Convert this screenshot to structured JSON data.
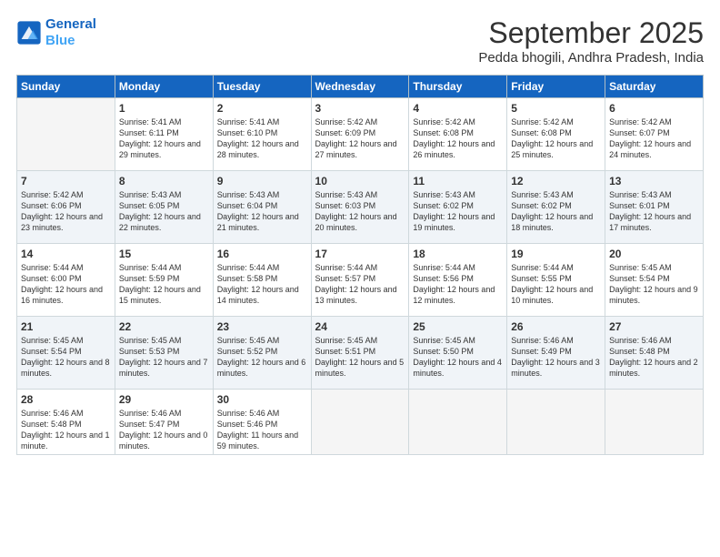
{
  "header": {
    "logo_line1": "General",
    "logo_line2": "Blue",
    "month": "September 2025",
    "location": "Pedda bhogili, Andhra Pradesh, India"
  },
  "weekdays": [
    "Sunday",
    "Monday",
    "Tuesday",
    "Wednesday",
    "Thursday",
    "Friday",
    "Saturday"
  ],
  "weeks": [
    [
      {
        "day": "",
        "info": ""
      },
      {
        "day": "1",
        "info": "Sunrise: 5:41 AM\nSunset: 6:11 PM\nDaylight: 12 hours\nand 29 minutes."
      },
      {
        "day": "2",
        "info": "Sunrise: 5:41 AM\nSunset: 6:10 PM\nDaylight: 12 hours\nand 28 minutes."
      },
      {
        "day": "3",
        "info": "Sunrise: 5:42 AM\nSunset: 6:09 PM\nDaylight: 12 hours\nand 27 minutes."
      },
      {
        "day": "4",
        "info": "Sunrise: 5:42 AM\nSunset: 6:08 PM\nDaylight: 12 hours\nand 26 minutes."
      },
      {
        "day": "5",
        "info": "Sunrise: 5:42 AM\nSunset: 6:08 PM\nDaylight: 12 hours\nand 25 minutes."
      },
      {
        "day": "6",
        "info": "Sunrise: 5:42 AM\nSunset: 6:07 PM\nDaylight: 12 hours\nand 24 minutes."
      }
    ],
    [
      {
        "day": "7",
        "info": "Sunrise: 5:42 AM\nSunset: 6:06 PM\nDaylight: 12 hours\nand 23 minutes."
      },
      {
        "day": "8",
        "info": "Sunrise: 5:43 AM\nSunset: 6:05 PM\nDaylight: 12 hours\nand 22 minutes."
      },
      {
        "day": "9",
        "info": "Sunrise: 5:43 AM\nSunset: 6:04 PM\nDaylight: 12 hours\nand 21 minutes."
      },
      {
        "day": "10",
        "info": "Sunrise: 5:43 AM\nSunset: 6:03 PM\nDaylight: 12 hours\nand 20 minutes."
      },
      {
        "day": "11",
        "info": "Sunrise: 5:43 AM\nSunset: 6:02 PM\nDaylight: 12 hours\nand 19 minutes."
      },
      {
        "day": "12",
        "info": "Sunrise: 5:43 AM\nSunset: 6:02 PM\nDaylight: 12 hours\nand 18 minutes."
      },
      {
        "day": "13",
        "info": "Sunrise: 5:43 AM\nSunset: 6:01 PM\nDaylight: 12 hours\nand 17 minutes."
      }
    ],
    [
      {
        "day": "14",
        "info": "Sunrise: 5:44 AM\nSunset: 6:00 PM\nDaylight: 12 hours\nand 16 minutes."
      },
      {
        "day": "15",
        "info": "Sunrise: 5:44 AM\nSunset: 5:59 PM\nDaylight: 12 hours\nand 15 minutes."
      },
      {
        "day": "16",
        "info": "Sunrise: 5:44 AM\nSunset: 5:58 PM\nDaylight: 12 hours\nand 14 minutes."
      },
      {
        "day": "17",
        "info": "Sunrise: 5:44 AM\nSunset: 5:57 PM\nDaylight: 12 hours\nand 13 minutes."
      },
      {
        "day": "18",
        "info": "Sunrise: 5:44 AM\nSunset: 5:56 PM\nDaylight: 12 hours\nand 12 minutes."
      },
      {
        "day": "19",
        "info": "Sunrise: 5:44 AM\nSunset: 5:55 PM\nDaylight: 12 hours\nand 10 minutes."
      },
      {
        "day": "20",
        "info": "Sunrise: 5:45 AM\nSunset: 5:54 PM\nDaylight: 12 hours\nand 9 minutes."
      }
    ],
    [
      {
        "day": "21",
        "info": "Sunrise: 5:45 AM\nSunset: 5:54 PM\nDaylight: 12 hours\nand 8 minutes."
      },
      {
        "day": "22",
        "info": "Sunrise: 5:45 AM\nSunset: 5:53 PM\nDaylight: 12 hours\nand 7 minutes."
      },
      {
        "day": "23",
        "info": "Sunrise: 5:45 AM\nSunset: 5:52 PM\nDaylight: 12 hours\nand 6 minutes."
      },
      {
        "day": "24",
        "info": "Sunrise: 5:45 AM\nSunset: 5:51 PM\nDaylight: 12 hours\nand 5 minutes."
      },
      {
        "day": "25",
        "info": "Sunrise: 5:45 AM\nSunset: 5:50 PM\nDaylight: 12 hours\nand 4 minutes."
      },
      {
        "day": "26",
        "info": "Sunrise: 5:46 AM\nSunset: 5:49 PM\nDaylight: 12 hours\nand 3 minutes."
      },
      {
        "day": "27",
        "info": "Sunrise: 5:46 AM\nSunset: 5:48 PM\nDaylight: 12 hours\nand 2 minutes."
      }
    ],
    [
      {
        "day": "28",
        "info": "Sunrise: 5:46 AM\nSunset: 5:48 PM\nDaylight: 12 hours\nand 1 minute."
      },
      {
        "day": "29",
        "info": "Sunrise: 5:46 AM\nSunset: 5:47 PM\nDaylight: 12 hours\nand 0 minutes."
      },
      {
        "day": "30",
        "info": "Sunrise: 5:46 AM\nSunset: 5:46 PM\nDaylight: 11 hours\nand 59 minutes."
      },
      {
        "day": "",
        "info": ""
      },
      {
        "day": "",
        "info": ""
      },
      {
        "day": "",
        "info": ""
      },
      {
        "day": "",
        "info": ""
      }
    ]
  ]
}
